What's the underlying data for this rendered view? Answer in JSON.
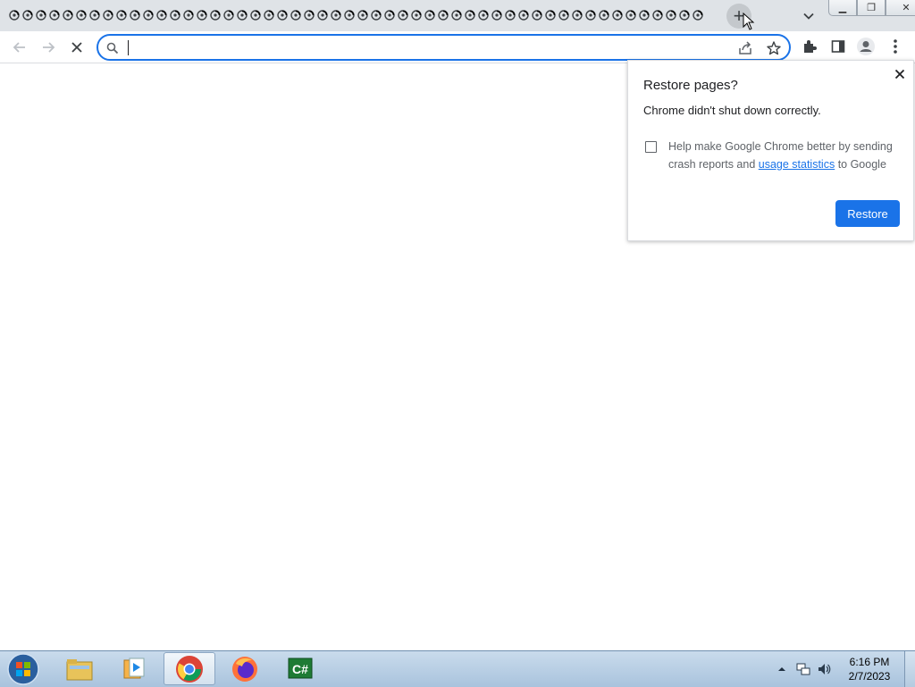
{
  "browser": {
    "tab_count": 52,
    "new_tab_glyph": "+",
    "window_buttons": {
      "minimize": "▁",
      "maximize": "❐",
      "close": "✕"
    }
  },
  "toolbar": {
    "omnibox_value": "",
    "omnibox_placeholder": "",
    "icons": [
      "back-arrow-icon",
      "forward-arrow-icon",
      "stop-loading-icon",
      "search-icon",
      "share-icon",
      "bookmark-star-icon",
      "extensions-icon",
      "side-panel-icon",
      "profile-icon",
      "menu-kebab-icon"
    ]
  },
  "popup": {
    "title": "Restore pages?",
    "message": "Chrome didn't shut down correctly.",
    "checkbox_checked": false,
    "checkbox_text_before": "Help make Google Chrome better by sending crash reports and ",
    "checkbox_link": "usage statistics",
    "checkbox_text_after": " to Google",
    "restore_label": "Restore",
    "close_glyph": "✕"
  },
  "taskbar": {
    "apps": [
      "windows-explorer",
      "media-player",
      "google-chrome",
      "firefox",
      "csharp-ide"
    ],
    "active_app": "google-chrome",
    "clock_time": "6:16 PM",
    "clock_date": "2/7/2023"
  },
  "colors": {
    "accent": "#1a73e8",
    "tabstrip": "#dfe3e7",
    "taskbar": "#b9d0e6"
  }
}
